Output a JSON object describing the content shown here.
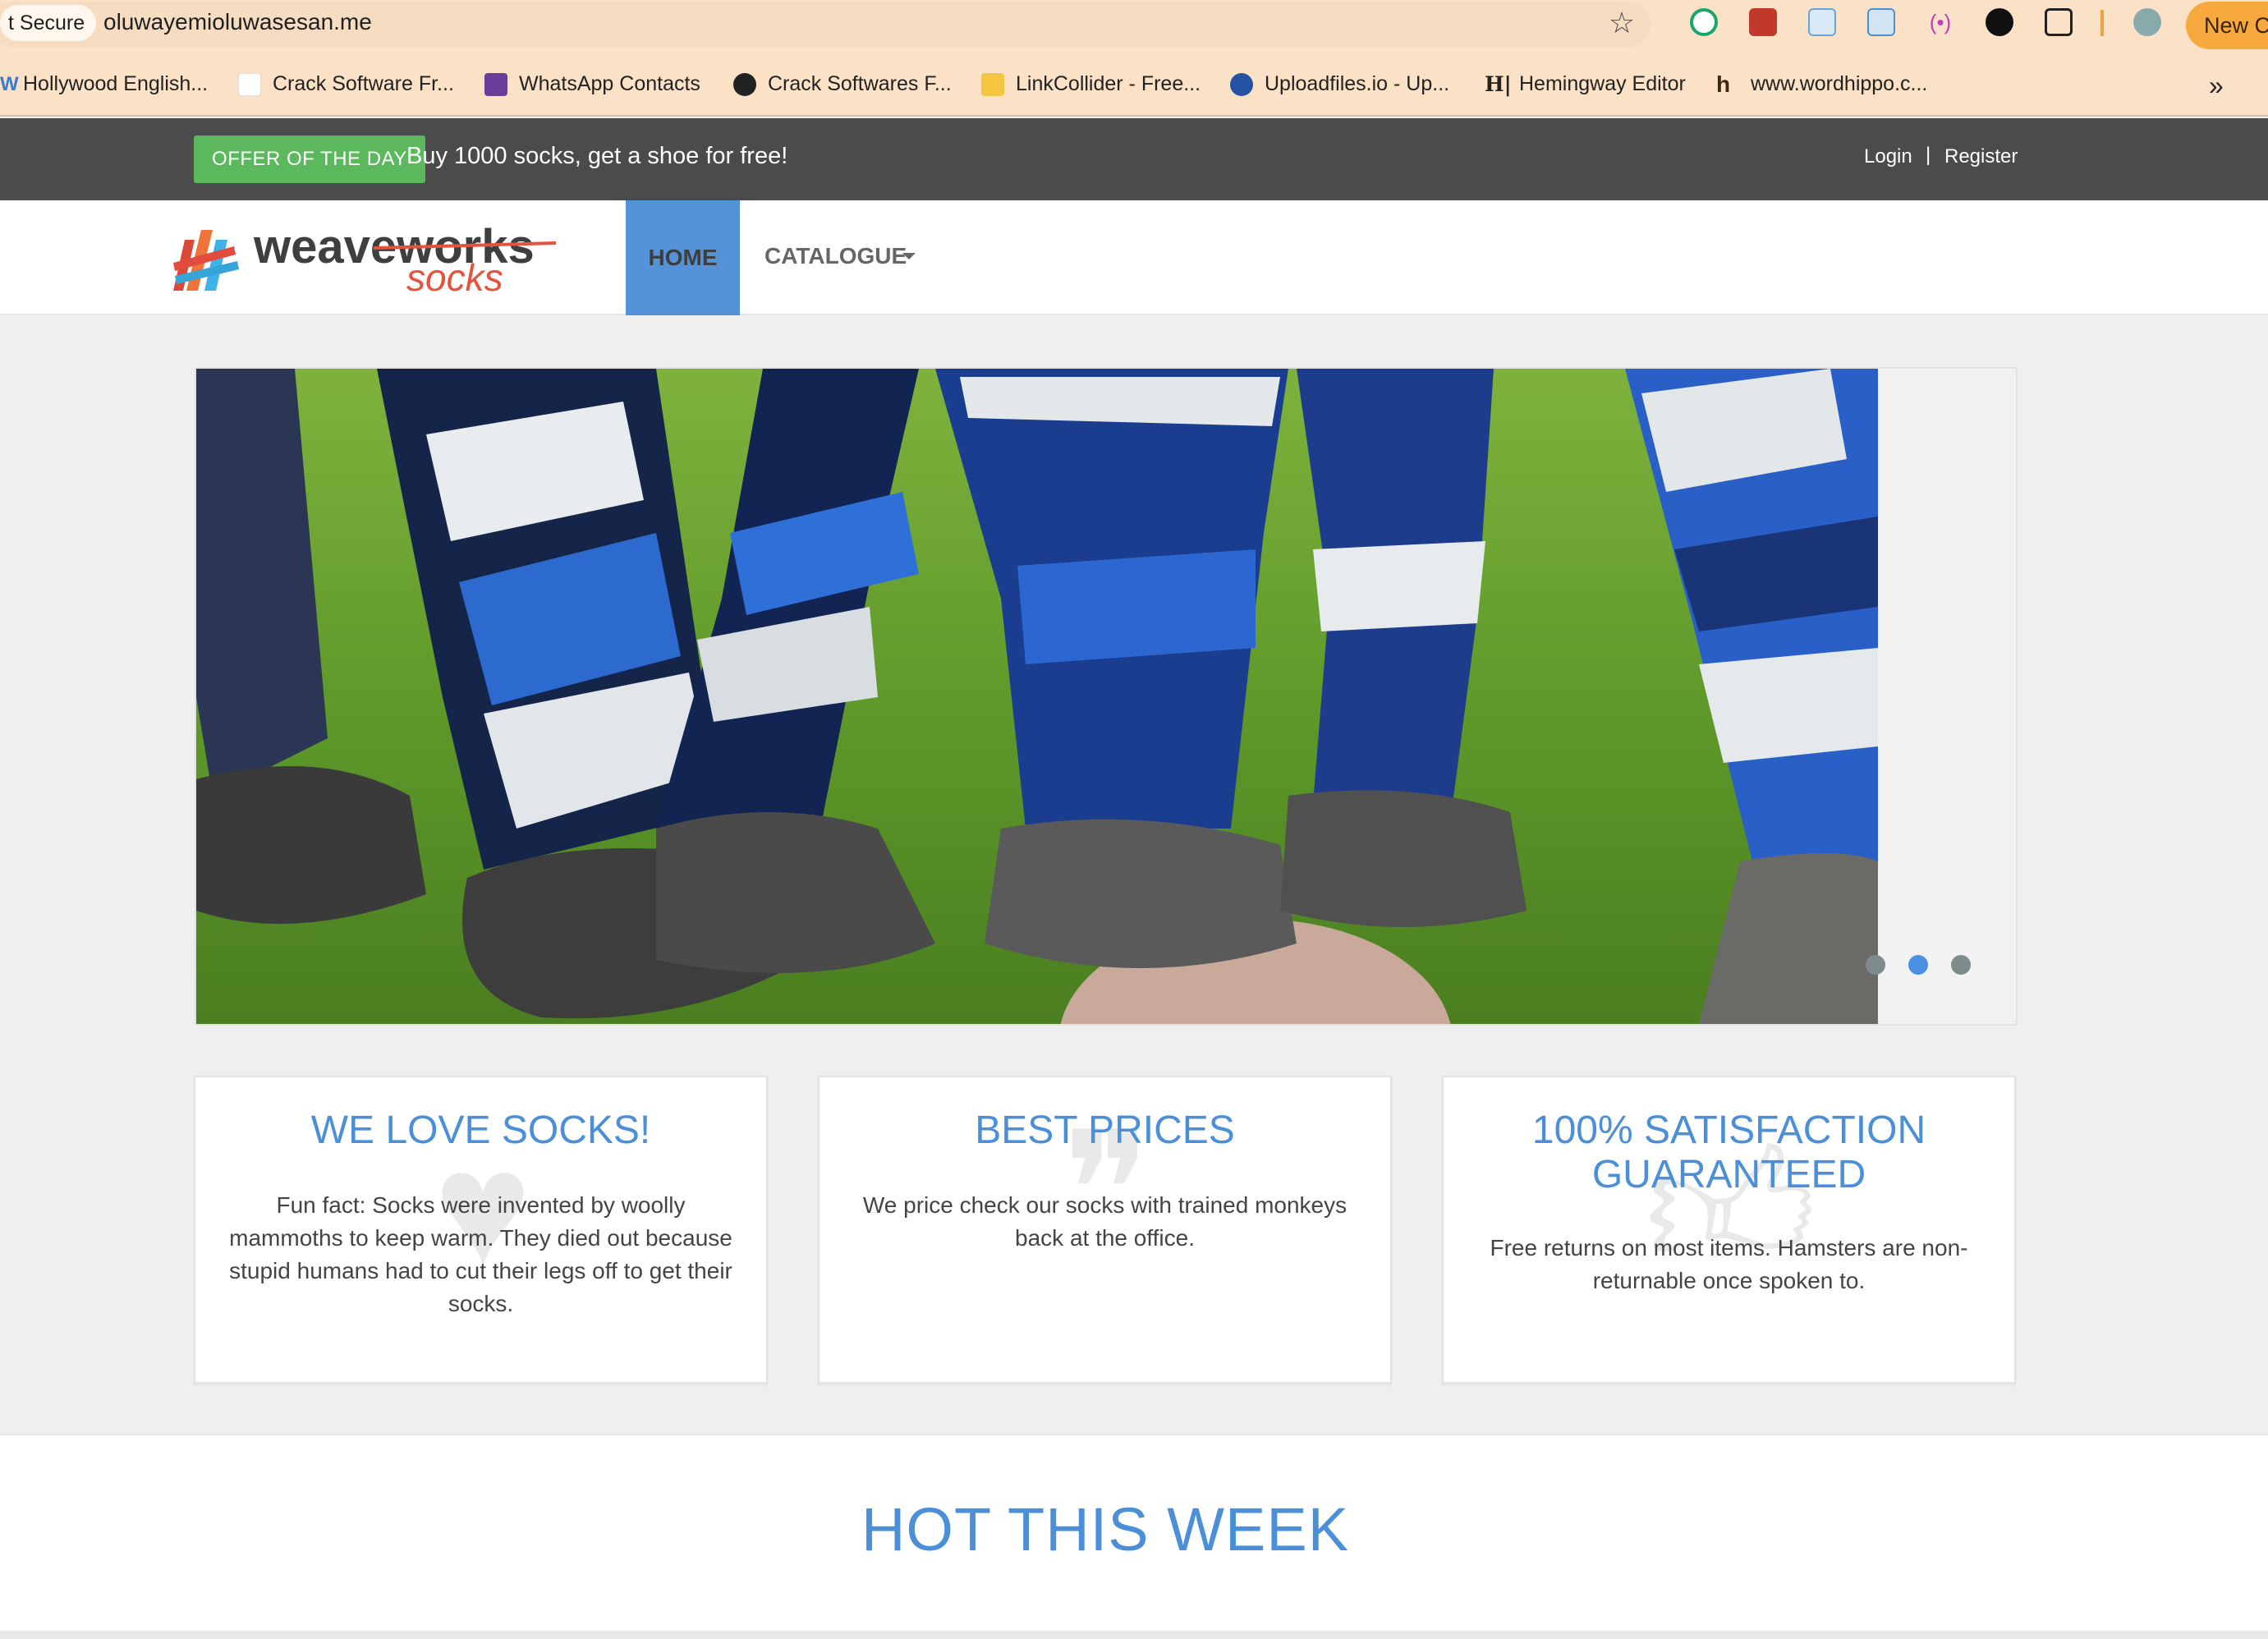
{
  "browser": {
    "secure_label": "t Secure",
    "url": "oluwayemioluwasesan.me",
    "new_chat_label": "New C",
    "bookmarks": [
      {
        "label": "Hollywood English...",
        "icon": "w-icon"
      },
      {
        "label": "Crack Software Fr...",
        "icon": "blank-page-icon"
      },
      {
        "label": "WhatsApp Contacts",
        "icon": "purple-square-icon"
      },
      {
        "label": "Crack Softwares F...",
        "icon": "globe-icon"
      },
      {
        "label": "LinkCollider - Free...",
        "icon": "linkcollider-icon"
      },
      {
        "label": "Uploadfiles.io - Up...",
        "icon": "uploadfiles-icon"
      },
      {
        "label": "Hemingway Editor",
        "icon": "hemingway-icon"
      },
      {
        "label": "www.wordhippo.c...",
        "icon": "wordhippo-icon"
      }
    ],
    "more_bookmarks": "»"
  },
  "topbar": {
    "offer_badge": "OFFER OF THE DAY",
    "offer_text": "Buy 1000 socks, get a shoe for free!",
    "login": "Login",
    "separator": "|",
    "register": "Register"
  },
  "header": {
    "logo_main": "weaveworks",
    "logo_sub": "socks",
    "nav_home": "HOME",
    "nav_catalogue": "CATALOGUE"
  },
  "carousel": {
    "slides": 3,
    "active_slide": 2
  },
  "features": [
    {
      "title": "WE LOVE SOCKS!",
      "body": "Fun fact: Socks were invented by woolly mammoths to keep warm. They died out because stupid humans had to cut their legs off to get their socks.",
      "icon": "heart-icon"
    },
    {
      "title": "BEST PRICES",
      "body": "We price check our socks with trained monkeys back at the office.",
      "icon": "quote-icon"
    },
    {
      "title": "100% SATISFACTION GUARANTEED",
      "body": "Free returns on most items. Hamsters are non-returnable once spoken to.",
      "icon": "thumbs-up-icon"
    }
  ],
  "hot": {
    "title": "HOT THIS WEEK"
  }
}
